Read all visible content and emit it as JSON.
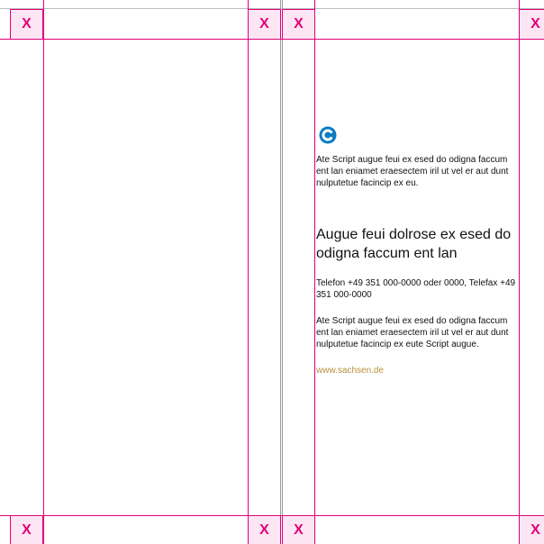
{
  "crop_marks": {
    "label": "X",
    "color": "#e2007a",
    "fill": "#fce6f3"
  },
  "page": {
    "logo": {
      "icon": "c-logo-icon",
      "letter": "C",
      "color": "#0a7bc4"
    },
    "intro": "Ate Script augue feui ex esed do odigna faccum ent lan eniamet eraesectem iril ut vel er aut dunt nulputetue facincip ex eu.",
    "heading": "Augue feui dolrose ex esed do odigna faccum ent lan",
    "contact": "Telefon +49 351 000-0000 oder 0000, Telefax +49 351 000-0000",
    "body": "Ate Script augue feui ex esed do odigna faccum ent lan eniamet eraesectem iril ut vel er aut dunt nulputetue facincip ex eute Script augue.",
    "link": "www.sachsen.de",
    "link_color": "#b8903a"
  }
}
